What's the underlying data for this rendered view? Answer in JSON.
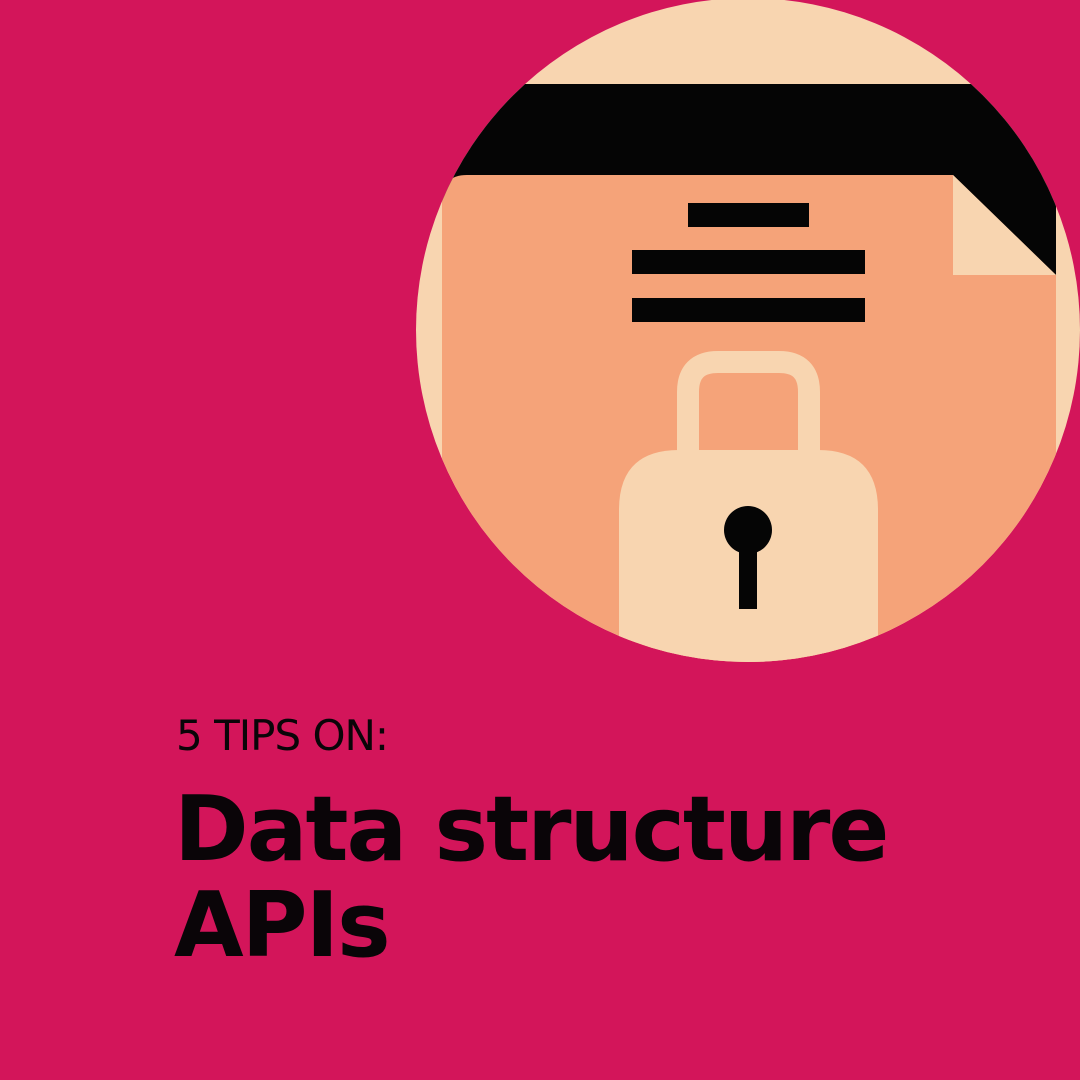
{
  "colors": {
    "background": "#d3155a",
    "circle": "#f8d5b0",
    "document": "#f5a379",
    "document_header": "#050505",
    "lock_body": "#f8d5b0",
    "text": "#0a0508"
  },
  "illustration": {
    "icons": [
      "document-icon",
      "padlock-icon",
      "keyhole-icon"
    ]
  },
  "text": {
    "eyebrow": "5 TIPS ON:",
    "headline_line1": "Data structure",
    "headline_line2": "APIs"
  }
}
